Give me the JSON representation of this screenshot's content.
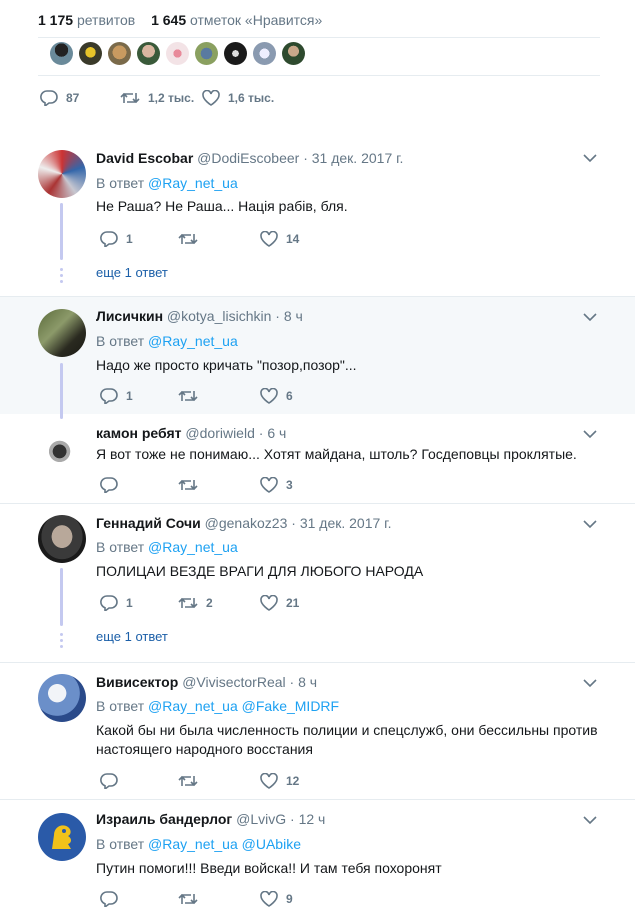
{
  "stats": {
    "retweets_count": "1 175",
    "retweets_label": "ретвитов",
    "likes_count": "1 645",
    "likes_label": "отметок «Нравится»"
  },
  "main_actions": {
    "replies": "87",
    "retweets": "1,2 тыс.",
    "likes": "1,6 тыс."
  },
  "colors": {
    "accent": "#1da1f2",
    "muted": "#657786",
    "thread": "#c4c9f0",
    "highlight": "#f5f8fa"
  },
  "replies": [
    {
      "name": "David Escobar",
      "handle": "@DodiEscobeer",
      "time": "31 дек. 2017 г.",
      "reply_prefix": "В ответ",
      "mentions": [
        "@Ray_net_ua"
      ],
      "text": "Не Раша? Не Раша... Нація рабів, бля.",
      "reply_count": "1",
      "retweet_count": "",
      "like_count": "14",
      "more": "еще 1 ответ"
    },
    {
      "name": "Лисичкин",
      "handle": "@kotya_lisichkin",
      "time": "8 ч",
      "reply_prefix": "В ответ",
      "mentions": [
        "@Ray_net_ua"
      ],
      "text": "Надо же просто кричать \"позор,позор\"...",
      "reply_count": "1",
      "retweet_count": "",
      "like_count": "6"
    },
    {
      "name": "камон ребят",
      "handle": "@doriwield",
      "time": "6 ч",
      "text": "Я вот тоже не понимаю... Хотят майдана, штоль? Госдеповцы проклятые.",
      "reply_count": "",
      "retweet_count": "",
      "like_count": "3"
    },
    {
      "name": "Геннадий Сочи",
      "handle": "@genakoz23",
      "time": "31 дек. 2017 г.",
      "reply_prefix": "В ответ",
      "mentions": [
        "@Ray_net_ua"
      ],
      "text": "ПОЛИЦАИ ВЕЗДЕ ВРАГИ ДЛЯ ЛЮБОГО НАРОДА",
      "reply_count": "1",
      "retweet_count": "2",
      "like_count": "21",
      "more": "еще 1 ответ"
    },
    {
      "name": "Вивисектор",
      "handle": "@VivisectorReal",
      "time": "8 ч",
      "reply_prefix": "В ответ",
      "mentions": [
        "@Ray_net_ua",
        "@Fake_MIDRF"
      ],
      "text_lines": [
        "Какой бы ни была численность полиции и спецслужб, они бессильны против",
        "настоящего народного восстания"
      ],
      "reply_count": "",
      "retweet_count": "",
      "like_count": "12"
    },
    {
      "name": "Израиль бандерлог",
      "handle": "@LvivG",
      "time": "12 ч",
      "reply_prefix": "В ответ",
      "mentions": [
        "@Ray_net_ua",
        "@UAbike"
      ],
      "text": "Путин помоги!!! Введи войска!! И там тебя похоронят",
      "reply_count": "",
      "retweet_count": "",
      "like_count": "9"
    }
  ]
}
